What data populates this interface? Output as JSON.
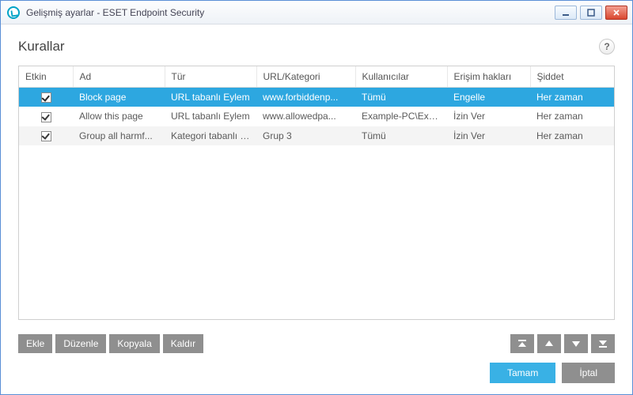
{
  "window": {
    "title": "Gelişmiş ayarlar - ESET Endpoint Security"
  },
  "header": {
    "title": "Kurallar",
    "help_symbol": "?"
  },
  "columns": {
    "etkin": "Etkin",
    "ad": "Ad",
    "tur": "Tür",
    "url": "URL/Kategori",
    "kullanicilar": "Kullanıcılar",
    "erisim": "Erişim hakları",
    "siddet": "Şiddet"
  },
  "rows": [
    {
      "etkin": true,
      "selected": true,
      "ad": "Block page",
      "tur": "URL tabanlı Eylem",
      "url": "www.forbiddenp...",
      "kullanicilar": "Tümü",
      "erisim": "Engelle",
      "siddet": "Her zaman"
    },
    {
      "etkin": true,
      "selected": false,
      "ad": "Allow this page",
      "tur": "URL tabanlı Eylem",
      "url": "www.allowedpa...",
      "kullanicilar": "Example-PC\\Exa...",
      "erisim": "İzin Ver",
      "siddet": "Her zaman"
    },
    {
      "etkin": true,
      "selected": false,
      "ad": "Group all harmf...",
      "tur": "Kategori tabanlı E...",
      "url": "Grup 3",
      "kullanicilar": "Tümü",
      "erisim": "İzin Ver",
      "siddet": "Her zaman"
    }
  ],
  "toolbar": {
    "ekle": "Ekle",
    "duzenle": "Düzenle",
    "kopyala": "Kopyala",
    "kaldir": "Kaldır"
  },
  "footer": {
    "tamam": "Tamam",
    "iptal": "İptal"
  }
}
